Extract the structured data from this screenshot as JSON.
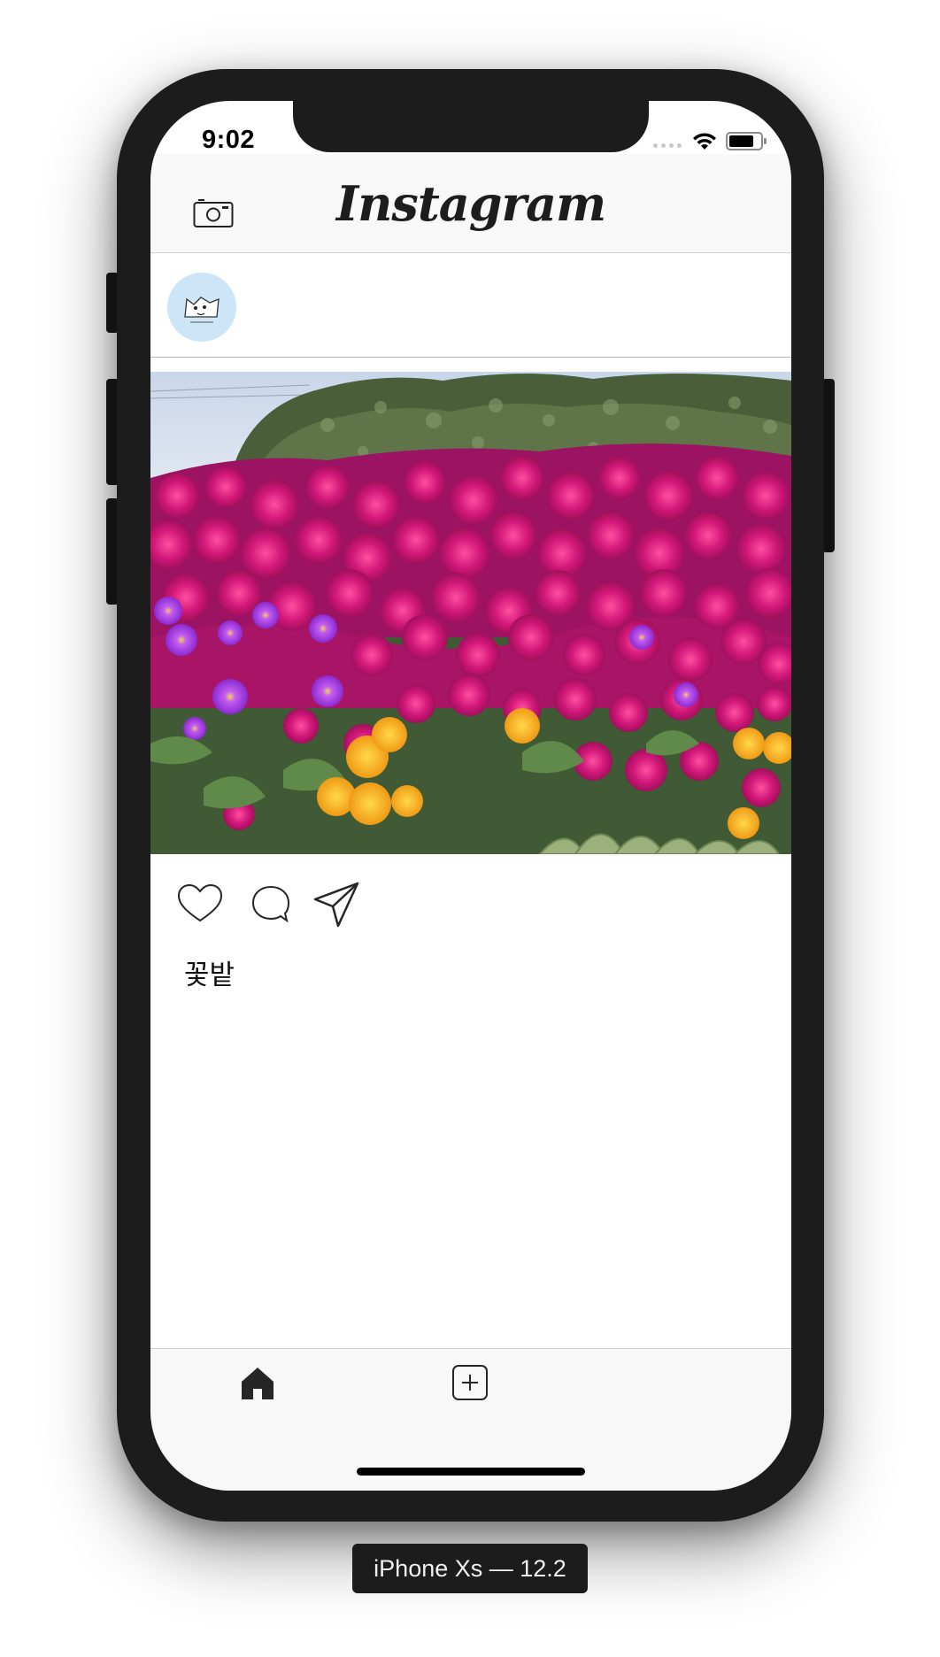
{
  "status_bar": {
    "time": "9:02"
  },
  "navbar": {
    "title": "Instagram",
    "left_icon": "camera-icon"
  },
  "post": {
    "avatar_icon": "avatar",
    "caption": "꽃밭",
    "actions": [
      "heart-icon",
      "comment-icon",
      "send-icon"
    ]
  },
  "tabbar": {
    "items": [
      "home-icon",
      "add-square-icon"
    ]
  },
  "device": {
    "label": "iPhone Xs — 12.2"
  }
}
